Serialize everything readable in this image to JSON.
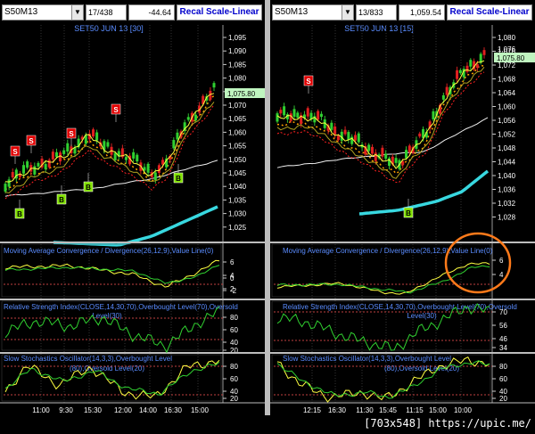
{
  "colors": {
    "accent": "#0000cc",
    "price_tag": "#bff5bf",
    "sell": "#e00000",
    "buy": "#80e000",
    "ma_long": "#38d8e0"
  },
  "left": {
    "symbol": "S50M13",
    "counter": "17/438",
    "price": "-44.64",
    "recal_label": "Recal Scale-Linear",
    "chart_title": "SET50 JUN 13   [30]",
    "last_price": "1,075.80",
    "price_axis": [
      "1,095",
      "1,090",
      "1,085",
      "1,080",
      "1,075",
      "1,070",
      "1,065",
      "1,060",
      "1,055",
      "1,050",
      "1,045",
      "1,040",
      "1,035",
      "1,030",
      "1,025"
    ],
    "macd_title": "Moving Average Convergence / Divergence(26,12,9),Value Line(0)",
    "macd_axis": [
      "6",
      "4",
      "2",
      "0",
      "-2"
    ],
    "rsi_title": "Relative Strength Index(CLOSE,14,30,70),Overbought Level(70),Oversold Level(30)",
    "rsi_axis": [
      "80",
      "60",
      "40",
      "20"
    ],
    "stoch_title": "Slow Stochastics Oscillator(14,3,3),Overbought Level(80),Oversold Level(20)",
    "stoch_axis": [
      "80",
      "60",
      "40",
      "20"
    ],
    "time_axis": [
      "11:00",
      "9:30",
      "15:30",
      "12:00",
      "14:00",
      "16:30",
      "15:00"
    ],
    "signals_sell": [
      "S",
      "S",
      "S",
      "S"
    ],
    "signals_buy": [
      "B",
      "B",
      "B",
      "B"
    ]
  },
  "right": {
    "symbol": "S50M13",
    "counter": "13/833",
    "price": "1,059.54",
    "recal_label": "Recal Scale-Linear",
    "chart_title": "SET50 JUN 13   [15]",
    "last_price": "1,075.80",
    "last_price_above": "1,076",
    "price_axis": [
      "1,080",
      "1,076",
      "1,072",
      "1,068",
      "1,064",
      "1,060",
      "1,056",
      "1,052",
      "1,048",
      "1,044",
      "1,040",
      "1,036",
      "1,032",
      "1,028"
    ],
    "macd_title": "Moving Average Convergence / Divergence(26,12,9),Value Line(0)",
    "macd_axis": [
      "6",
      "4"
    ],
    "rsi_title": "Relative Strength Index(CLOSE,14,30,70),Overbought Level(70),Oversold Level(30)",
    "rsi_axis": [
      "70",
      "56",
      "46",
      "34"
    ],
    "stoch_title": "Slow Stochastics Oscillator(14,3,3),Overbought Level(80),Oversold Level(20)",
    "stoch_axis": [
      "80",
      "60",
      "40",
      "20"
    ],
    "time_axis": [
      "12:15",
      "16:30",
      "11:30",
      "15:45",
      "11:15",
      "15:00",
      "10:00"
    ],
    "signals_sell": [
      "S"
    ],
    "signals_buy": [
      "B"
    ]
  },
  "footer": {
    "credit": "[703x548] https://upic.me/"
  }
}
